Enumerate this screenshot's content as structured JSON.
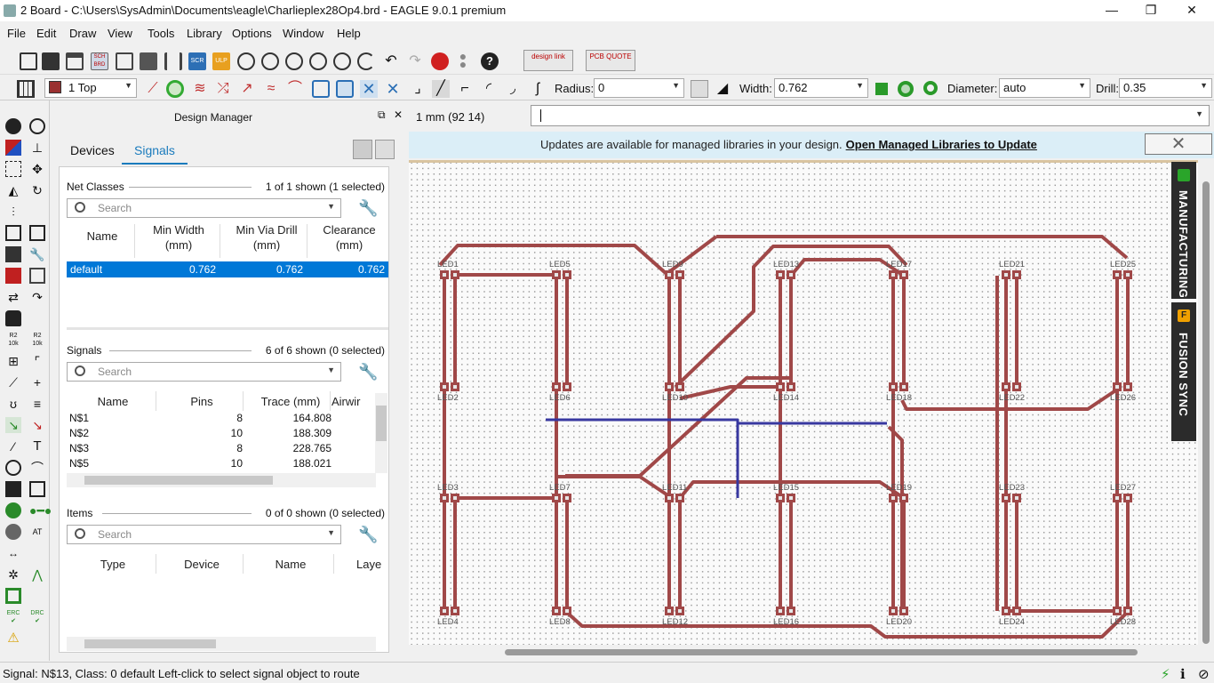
{
  "window": {
    "title": "2 Board - C:\\Users\\SysAdmin\\Documents\\eagle\\Charlieplex28Op4.brd - EAGLE 9.0.1 premium",
    "minimize": "—",
    "restore": "❐",
    "close": "✕"
  },
  "menu": [
    "File",
    "Edit",
    "Draw",
    "View",
    "Tools",
    "Library",
    "Options",
    "Window",
    "Help"
  ],
  "toolbar": {
    "design_link": "design link",
    "pcb_quote": "PCB QUOTE",
    "scr_label": "SCR",
    "ulp_label": "ULP"
  },
  "toolbar2": {
    "layer": "1 Top",
    "layer_color": "#9a3030",
    "radius_label": "Radius:",
    "radius_value": "0",
    "width_label": "Width:",
    "width_value": "0.762",
    "diameter_label": "Diameter:",
    "diameter_value": "auto",
    "drill_label": "Drill:",
    "drill_value": "0.35"
  },
  "design_manager": {
    "title": "Design Manager",
    "tabs": [
      "Devices",
      "Signals"
    ],
    "active_tab": "Signals",
    "net_classes": {
      "label": "Net Classes",
      "count": "1 of 1 shown (1 selected)",
      "search_placeholder": "Search",
      "columns": [
        "Name",
        "Min Width\n(mm)",
        "Min Via Drill\n(mm)",
        "Clearance\n(mm)"
      ],
      "rows": [
        {
          "name": "default",
          "min_width": "0.762",
          "min_via": "0.762",
          "clearance": "0.762"
        }
      ]
    },
    "signals": {
      "label": "Signals",
      "count": "6 of 6 shown (0 selected)",
      "search_placeholder": "Search",
      "columns": [
        "Name",
        "Pins",
        "Trace (mm)",
        "Airwir"
      ],
      "rows": [
        {
          "name": "N$1",
          "pins": "8",
          "trace": "164.808"
        },
        {
          "name": "N$2",
          "pins": "10",
          "trace": "188.309"
        },
        {
          "name": "N$3",
          "pins": "8",
          "trace": "228.765"
        },
        {
          "name": "N$5",
          "pins": "10",
          "trace": "188.021"
        }
      ]
    },
    "items": {
      "label": "Items",
      "count": "0 of 0 shown (0 selected)",
      "search_placeholder": "Search",
      "columns": [
        "Type",
        "Device",
        "Name",
        "Laye"
      ]
    }
  },
  "coordinate": "1 mm (92 14)",
  "banner": {
    "message": "Updates are available for managed libraries in your design.",
    "link": "Open Managed Libraries to Update",
    "close": "✕"
  },
  "side_tabs": {
    "manufacturing": "MANUFACTURING",
    "fusion_sync": "FUSION SYNC",
    "fusion_badge": "F"
  },
  "board": {
    "leds_top": [
      "LED1",
      "LED5",
      "LED9",
      "LED13",
      "LED17",
      "LED21",
      "LED25"
    ],
    "leds_row2": [
      "LED2",
      "LED6",
      "LED10",
      "LED14",
      "LED18",
      "LED22",
      "LED26"
    ],
    "leds_row3": [
      "LED3",
      "LED7",
      "LED11",
      "LED15",
      "LED19",
      "LED23",
      "LED27"
    ],
    "leds_bottom": [
      "LED4",
      "LED8",
      "LED12",
      "LED16",
      "LED20",
      "LED24",
      "LED28"
    ],
    "trace_color": "#a04848",
    "bottom_trace_color": "#3838a0"
  },
  "status": {
    "text": "Signal: N$13, Class: 0 default Left-click to select signal object to route"
  }
}
